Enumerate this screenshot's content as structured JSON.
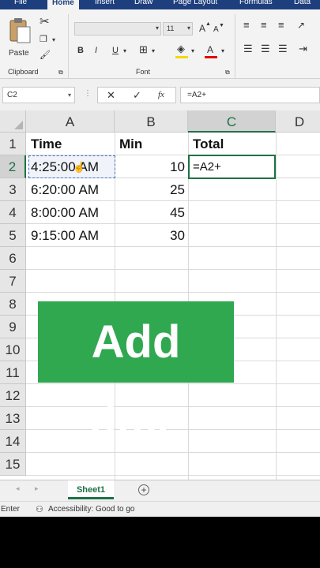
{
  "ribbon": {
    "tabs": [
      "File",
      "Home",
      "Insert",
      "Draw",
      "Page Layout",
      "Formulas",
      "Data"
    ],
    "active_tab": "Home",
    "clipboard": {
      "paste_label": "Paste",
      "group_label": "Clipboard"
    },
    "font": {
      "size": "11",
      "bold": "B",
      "italic": "I",
      "underline": "U",
      "font_color": "A",
      "group_label": "Font",
      "grow": "A",
      "shrink": "A"
    }
  },
  "formula_bar": {
    "name_box": "C2",
    "cancel": "✕",
    "enter": "✓",
    "fx": "fx",
    "value": "=A2+"
  },
  "grid": {
    "columns": [
      "A",
      "B",
      "C",
      "D"
    ],
    "rows": [
      "1",
      "2",
      "3",
      "4",
      "5",
      "6",
      "7",
      "8",
      "9",
      "10",
      "11",
      "12",
      "13",
      "14",
      "15"
    ],
    "cells": {
      "A1": "Time",
      "B1": "Min",
      "C1": "Total",
      "A2": "4:25:00 AM",
      "B2": "10",
      "C2": "=A2+",
      "A3": "6:20:00 AM",
      "B3": "25",
      "A4": "8:00:00 AM",
      "B4": "45",
      "A5": "9:15:00 AM",
      "B5": "30"
    },
    "active_cell": "C2"
  },
  "overlay": {
    "text": "Add time",
    "color": "#2fa84f"
  },
  "sheets": {
    "tabs": [
      "Sheet1"
    ],
    "add": "+"
  },
  "status": {
    "mode": "Enter",
    "accessibility": "Accessibility: Good to go"
  },
  "colors": {
    "accent": "#1e7145",
    "ribbon_bar": "#1e3f7e"
  }
}
